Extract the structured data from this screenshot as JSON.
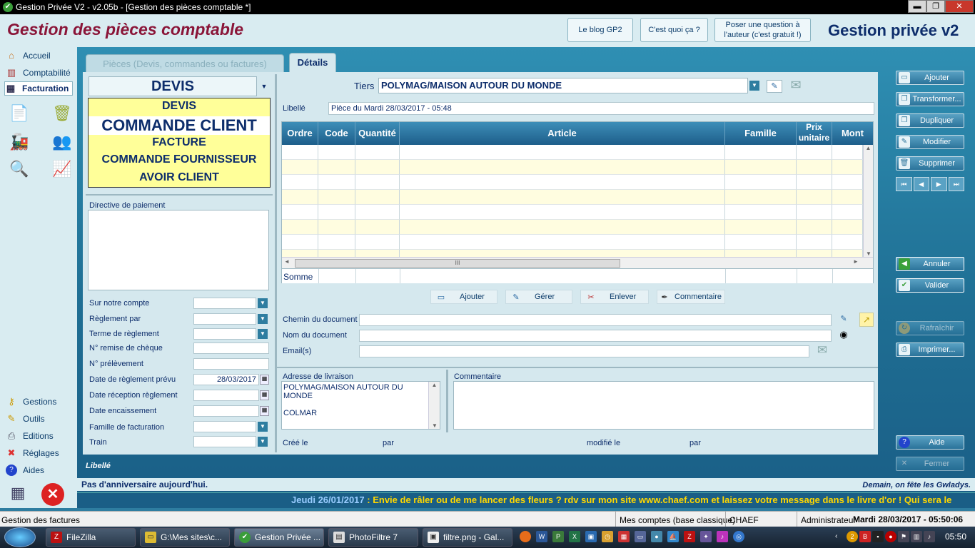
{
  "window": {
    "title": "Gestion Privée V2 - v2.05b - [Gestion des pièces comptable *]",
    "min": "▬",
    "restore": "❐",
    "close": "✕"
  },
  "header": {
    "page_title": "Gestion des pièces comptable",
    "blog_button": "Le blog GP2",
    "what_button": "C'est quoi ça ?",
    "question_button_line1": "Poser une question à",
    "question_button_line2": "l'auteur (c'est gratuit !)",
    "app_name": "Gestion privée v2"
  },
  "leftnav": {
    "items": [
      {
        "label": "Accueil",
        "icon": "home-icon"
      },
      {
        "label": "Comptabilité",
        "icon": "books-icon"
      },
      {
        "label": "Facturation",
        "icon": "calculator-icon"
      }
    ],
    "bottom_items": [
      {
        "label": "Gestions",
        "icon": "key-icon"
      },
      {
        "label": "Outils",
        "icon": "wrench-icon"
      },
      {
        "label": "Editions",
        "icon": "printer-icon"
      },
      {
        "label": "Réglages",
        "icon": "settings-icon"
      },
      {
        "label": "Aides",
        "icon": "help-icon"
      }
    ]
  },
  "tabs": {
    "pieces": "Pièces (Devis, commandes ou factures)",
    "details": "Détails"
  },
  "document": {
    "type_selected": "DEVIS",
    "type_options": [
      "DEVIS",
      "COMMANDE CLIENT",
      "FACTURE",
      "COMMANDE FOURNISSEUR",
      "AVOIR CLIENT"
    ],
    "tiers_label": "Tiers",
    "tiers_value": "POLYMAG/MAISON AUTOUR DU MONDE",
    "libelle_label": "Libellé",
    "libelle_value": "Pièce du Mardi 28/03/2017 - 05:48"
  },
  "payment": {
    "directive_label": "Directive de paiement",
    "fields": [
      {
        "label": "Sur notre compte",
        "value": "",
        "combo": true
      },
      {
        "label": "Règlement par",
        "value": "",
        "combo": true
      },
      {
        "label": "Terme de règlement",
        "value": "",
        "combo": true
      },
      {
        "label": "N° remise de chèque",
        "value": "",
        "combo": false
      },
      {
        "label": "N° prélèvement",
        "value": "",
        "combo": false
      },
      {
        "label": "Date de règlement prévu",
        "value": "28/03/2017",
        "combo": false
      },
      {
        "label": "Date réception règlement",
        "value": "",
        "combo": false
      },
      {
        "label": "Date encaissement",
        "value": "",
        "combo": false
      },
      {
        "label": "Famille de facturation",
        "value": "",
        "combo": true
      },
      {
        "label": "Train",
        "value": "",
        "combo": true
      }
    ]
  },
  "grid": {
    "columns": [
      "Ordre",
      "Code",
      "Quantité",
      "Article",
      "Famille",
      "Prix unitaire",
      "Mont"
    ],
    "somme_label": "Somme",
    "scroll_thumb": "III"
  },
  "grid_actions": {
    "ajouter": "Ajouter",
    "gerer": "Gérer",
    "enlever": "Enlever",
    "commentaire": "Commentaire"
  },
  "files": {
    "chemin_label": "Chemin du document",
    "nom_label": "Nom du document",
    "email_label": "Email(s)"
  },
  "address": {
    "label": "Adresse de livraison",
    "line1": "POLYMAG/MAISON AUTOUR DU",
    "line2": "MONDE",
    "line3": "COLMAR",
    "comment_label": "Commentaire"
  },
  "audit": {
    "cree_le": "Créé le",
    "par1": "par",
    "modifie_le": "modifié le",
    "par2": "par"
  },
  "sidebar_buttons": {
    "ajouter": "Ajouter",
    "transformer": "Transformer...",
    "dupliquer": "Dupliquer",
    "modifier": "Modifier",
    "supprimer": "Supprimer",
    "annuler": "Annuler",
    "valider": "Valider",
    "rafraichir": "Rafraîchir",
    "imprimer": "Imprimer...",
    "aide": "Aide",
    "fermer": "Fermer"
  },
  "footer": {
    "libelle": "Libellé",
    "birthday": "Pas d'anniversaire aujourd'hui.",
    "saint": "Demain, on fête les Gwladys.",
    "ticker_date": "Jeudi 26/01/2017",
    "ticker_text": ": Envie de râler ou de me lancer des fleurs ? rdv sur mon site www.chaef.com et laissez votre message dans le livre d'or ! Qui sera le"
  },
  "statusbar": {
    "left": "Gestion des factures",
    "comptes": "Mes comptes (base classique)",
    "user": "CHAEF",
    "role": "Administrateur",
    "datetime": "Mardi 28/03/2017 - 05:50:06"
  },
  "taskbar": {
    "items": [
      "FileZilla",
      "G:\\Mes sites\\c...",
      "Gestion Privée ...",
      "PhotoFiltre 7",
      "filtre.png - Gal..."
    ],
    "clock": "05:50"
  }
}
